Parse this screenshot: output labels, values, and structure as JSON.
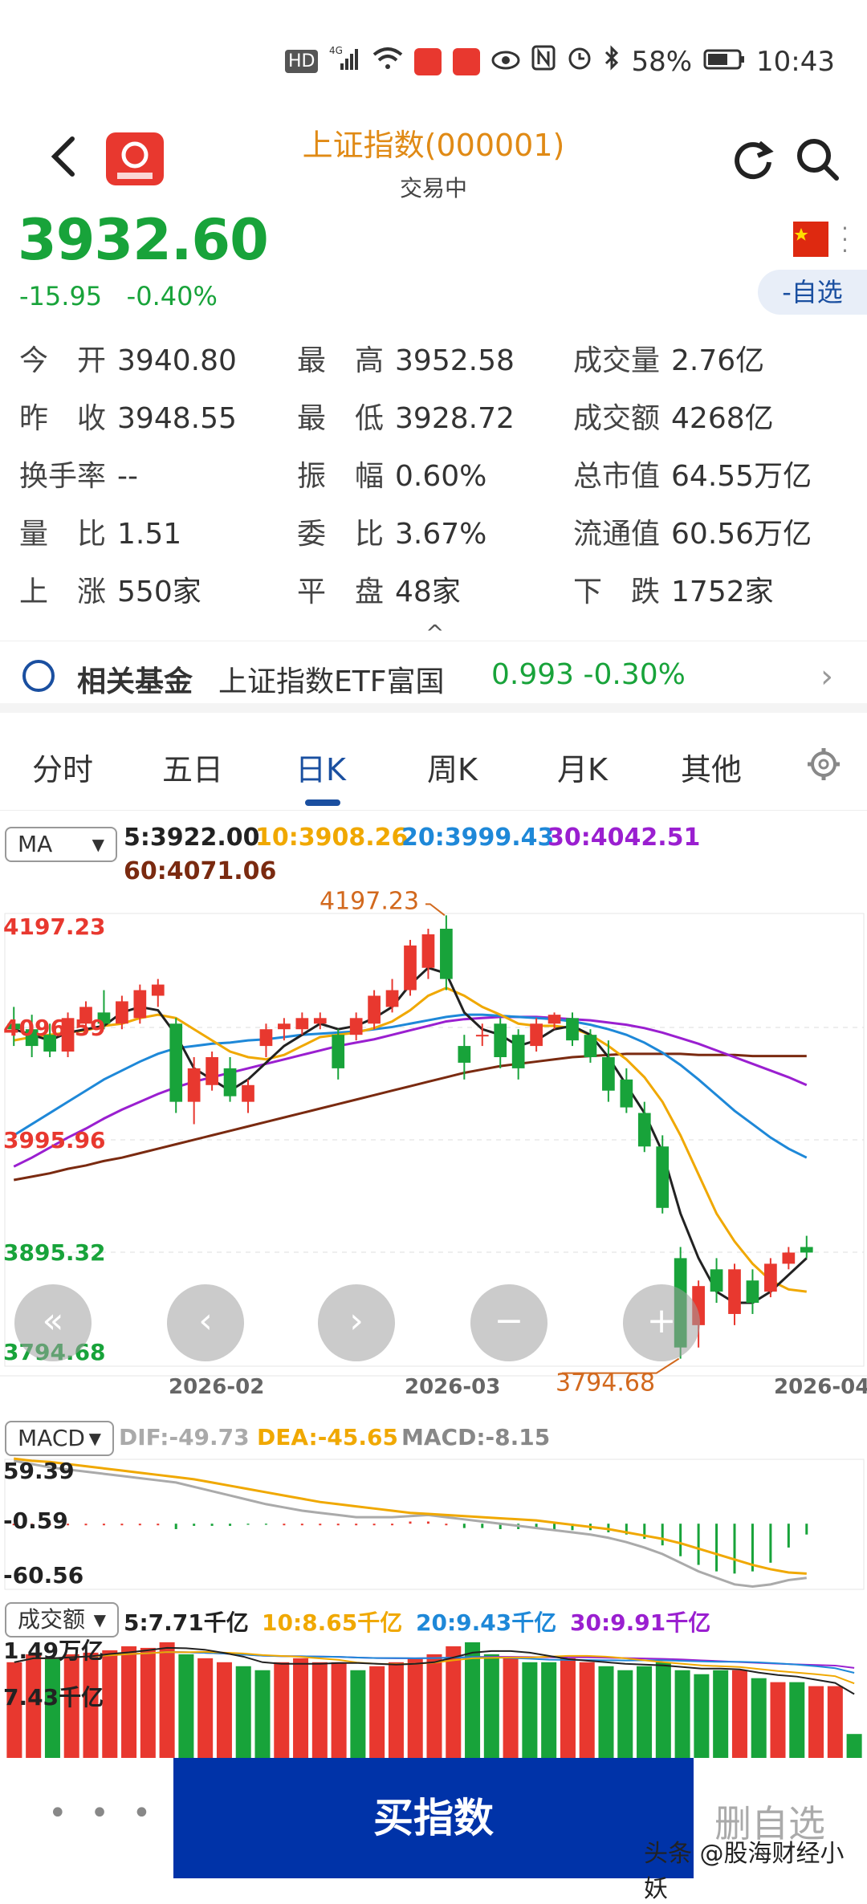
{
  "status_bar": {
    "battery": "58%",
    "time": "10:43",
    "hd": "HD",
    "net": "4G"
  },
  "header": {
    "title": "上证指数(000001)",
    "subtitle": "交易中"
  },
  "quote": {
    "price": "3932.60",
    "change": "-15.95",
    "change_pct": "-0.40%",
    "watch_label": "-自选"
  },
  "stats": [
    {
      "label": "今　开",
      "value": "3940.80"
    },
    {
      "label": "最　高",
      "value": "3952.58"
    },
    {
      "label": "成交量",
      "value": "2.76亿"
    },
    {
      "label": "昨　收",
      "value": "3948.55"
    },
    {
      "label": "最　低",
      "value": "3928.72"
    },
    {
      "label": "成交额",
      "value": "4268亿"
    },
    {
      "label": "换手率",
      "value": "--"
    },
    {
      "label": "振　幅",
      "value": "0.60%"
    },
    {
      "label": "总市值",
      "value": "64.55万亿"
    },
    {
      "label": "量　比",
      "value": "1.51"
    },
    {
      "label": "委　比",
      "value": "3.67%"
    },
    {
      "label": "流通值",
      "value": "60.56万亿"
    },
    {
      "label": "上　涨",
      "value": "550家"
    },
    {
      "label": "平　盘",
      "value": "48家"
    },
    {
      "label": "下　跌",
      "value": "1752家"
    }
  ],
  "fund": {
    "label": "相关基金",
    "name": "上证指数ETF富国",
    "value": "0.993 -0.30%"
  },
  "tabs": [
    "分时",
    "五日",
    "日K",
    "周K",
    "月K",
    "其他"
  ],
  "active_tab": "日K",
  "ma_panel": {
    "selector": "MA",
    "ma5": "5:3922.00",
    "ma10": "10:3908.26",
    "ma20": "20:3999.43",
    "ma30": "30:4042.51",
    "ma60": "60:4071.06"
  },
  "macd_panel": {
    "selector": "MACD",
    "dif": "DIF:-49.73",
    "dea": "DEA:-45.65",
    "macd": "MACD:-8.15"
  },
  "vol_panel": {
    "selector": "成交额",
    "ma5": "5:7.71千亿",
    "ma10": "10:8.65千亿",
    "ma20": "20:9.43千亿",
    "ma30": "30:9.91千亿"
  },
  "nav_buttons": [
    "«",
    "‹",
    "›",
    "−",
    "+"
  ],
  "bottom": {
    "more": "• • •",
    "buy": "买指数",
    "delete": "删自选",
    "watermark": "头条 @股海财经小妖"
  },
  "colors": {
    "up": "#e8382f",
    "down": "#18a33a",
    "ma5": "#222222",
    "ma10": "#f0a800",
    "ma20": "#1e88d8",
    "ma30": "#9a1fd0",
    "ma60": "#7a2a10",
    "accent": "#1a4fa0"
  },
  "chart_data": [
    {
      "type": "candlestick",
      "title": "",
      "x_labels": [
        "2026-02",
        "2026-03",
        "2026-04"
      ],
      "y_labels": [
        "4197.23",
        "4096.59",
        "3995.96",
        "3895.32",
        "3794.68"
      ],
      "ylim": [
        3794.68,
        4197.23
      ],
      "max_annotation": "4197.23",
      "min_annotation": "3794.68",
      "candles": [
        {
          "o": 4100,
          "h": 4115,
          "l": 4080,
          "c": 4095
        },
        {
          "o": 4095,
          "h": 4108,
          "l": 4070,
          "c": 4080
        },
        {
          "o": 4090,
          "h": 4100,
          "l": 4070,
          "c": 4075
        },
        {
          "o": 4075,
          "h": 4110,
          "l": 4070,
          "c": 4105
        },
        {
          "o": 4100,
          "h": 4120,
          "l": 4090,
          "c": 4115
        },
        {
          "o": 4110,
          "h": 4130,
          "l": 4095,
          "c": 4100
        },
        {
          "o": 4100,
          "h": 4125,
          "l": 4095,
          "c": 4120
        },
        {
          "o": 4105,
          "h": 4135,
          "l": 4100,
          "c": 4130
        },
        {
          "o": 4125,
          "h": 4140,
          "l": 4115,
          "c": 4135
        },
        {
          "o": 4100,
          "h": 4105,
          "l": 4020,
          "c": 4030
        },
        {
          "o": 4030,
          "h": 4070,
          "l": 4010,
          "c": 4060
        },
        {
          "o": 4045,
          "h": 4075,
          "l": 4040,
          "c": 4070
        },
        {
          "o": 4060,
          "h": 4070,
          "l": 4030,
          "c": 4035
        },
        {
          "o": 4030,
          "h": 4050,
          "l": 4020,
          "c": 4045
        },
        {
          "o": 4080,
          "h": 4100,
          "l": 4070,
          "c": 4095
        },
        {
          "o": 4095,
          "h": 4105,
          "l": 4085,
          "c": 4100
        },
        {
          "o": 4095,
          "h": 4110,
          "l": 4090,
          "c": 4105
        },
        {
          "o": 4100,
          "h": 4110,
          "l": 4095,
          "c": 4105
        },
        {
          "o": 4090,
          "h": 4095,
          "l": 4050,
          "c": 4060
        },
        {
          "o": 4090,
          "h": 4110,
          "l": 4085,
          "c": 4105
        },
        {
          "o": 4100,
          "h": 4130,
          "l": 4095,
          "c": 4125
        },
        {
          "o": 4115,
          "h": 4140,
          "l": 4110,
          "c": 4130
        },
        {
          "o": 4130,
          "h": 4175,
          "l": 4125,
          "c": 4170
        },
        {
          "o": 4150,
          "h": 4185,
          "l": 4140,
          "c": 4180
        },
        {
          "o": 4185,
          "h": 4197,
          "l": 4130,
          "c": 4140
        },
        {
          "o": 4080,
          "h": 4090,
          "l": 4050,
          "c": 4065
        },
        {
          "o": 4090,
          "h": 4100,
          "l": 4080,
          "c": 4090
        },
        {
          "o": 4100,
          "h": 4105,
          "l": 4060,
          "c": 4070
        },
        {
          "o": 4090,
          "h": 4095,
          "l": 4050,
          "c": 4060
        },
        {
          "o": 4080,
          "h": 4105,
          "l": 4075,
          "c": 4100
        },
        {
          "o": 4100,
          "h": 4110,
          "l": 4095,
          "c": 4108
        },
        {
          "o": 4105,
          "h": 4110,
          "l": 4080,
          "c": 4085
        },
        {
          "o": 4090,
          "h": 4095,
          "l": 4065,
          "c": 4070
        },
        {
          "o": 4070,
          "h": 4085,
          "l": 4030,
          "c": 4040
        },
        {
          "o": 4050,
          "h": 4060,
          "l": 4020,
          "c": 4025
        },
        {
          "o": 4020,
          "h": 4030,
          "l": 3985,
          "c": 3990
        },
        {
          "o": 3990,
          "h": 4000,
          "l": 3930,
          "c": 3935
        },
        {
          "o": 3890,
          "h": 3900,
          "l": 3800,
          "c": 3810
        },
        {
          "o": 3830,
          "h": 3870,
          "l": 3810,
          "c": 3865
        },
        {
          "o": 3880,
          "h": 3890,
          "l": 3850,
          "c": 3860
        },
        {
          "o": 3840,
          "h": 3885,
          "l": 3830,
          "c": 3880
        },
        {
          "o": 3870,
          "h": 3880,
          "l": 3840,
          "c": 3850
        },
        {
          "o": 3860,
          "h": 3890,
          "l": 3855,
          "c": 3885
        },
        {
          "o": 3885,
          "h": 3900,
          "l": 3880,
          "c": 3895
        },
        {
          "o": 3900,
          "h": 3910,
          "l": 3890,
          "c": 3895
        }
      ],
      "ma5": [
        4095,
        4090,
        4085,
        4092,
        4095,
        4098,
        4110,
        4115,
        4112,
        4090,
        4060,
        4050,
        4040,
        4050,
        4065,
        4080,
        4090,
        4100,
        4095,
        4098,
        4105,
        4115,
        4135,
        4150,
        4145,
        4110,
        4095,
        4090,
        4080,
        4085,
        4095,
        4098,
        4090,
        4070,
        4045,
        4020,
        3985,
        3930,
        3890,
        3860,
        3850,
        3850,
        3860,
        3875,
        3890
      ],
      "ma10": [
        4085,
        4088,
        4090,
        4092,
        4094,
        4098,
        4100,
        4105,
        4108,
        4105,
        4095,
        4085,
        4075,
        4070,
        4068,
        4072,
        4080,
        4088,
        4090,
        4092,
        4096,
        4102,
        4112,
        4125,
        4132,
        4125,
        4115,
        4108,
        4100,
        4098,
        4098,
        4096,
        4090,
        4080,
        4068,
        4052,
        4030,
        4000,
        3965,
        3930,
        3905,
        3885,
        3870,
        3862,
        3860
      ],
      "ma20": [
        4000,
        4010,
        4020,
        4030,
        4040,
        4050,
        4058,
        4066,
        4073,
        4078,
        4080,
        4082,
        4083,
        4085,
        4086,
        4088,
        4090,
        4091,
        4092,
        4093,
        4095,
        4097,
        4100,
        4103,
        4106,
        4108,
        4108,
        4107,
        4106,
        4105,
        4104,
        4102,
        4099,
        4095,
        4090,
        4083,
        4074,
        4063,
        4050,
        4036,
        4022,
        4010,
        3998,
        3988,
        3980
      ],
      "ma30": [
        3972,
        3980,
        3989,
        3998,
        4006,
        4015,
        4023,
        4030,
        4037,
        4043,
        4048,
        4052,
        4056,
        4060,
        4064,
        4068,
        4072,
        4076,
        4080,
        4083,
        4086,
        4090,
        4094,
        4098,
        4102,
        4104,
        4105,
        4106,
        4106,
        4106,
        4105,
        4104,
        4103,
        4101,
        4099,
        4096,
        4092,
        4087,
        4082,
        4076,
        4070,
        4064,
        4058,
        4052,
        4045
      ],
      "ma60": [
        3960,
        3963,
        3966,
        3970,
        3973,
        3977,
        3980,
        3984,
        3988,
        3992,
        3996,
        4000,
        4004,
        4008,
        4012,
        4016,
        4020,
        4024,
        4028,
        4032,
        4036,
        4040,
        4044,
        4048,
        4052,
        4056,
        4059,
        4062,
        4064,
        4066,
        4068,
        4070,
        4071,
        4072,
        4073,
        4073,
        4073,
        4073,
        4072,
        4072,
        4072,
        4071,
        4071,
        4071,
        4071
      ]
    },
    {
      "type": "bar",
      "title": "MACD",
      "y_labels": [
        "59.39",
        "-0.59",
        "-60.56"
      ],
      "ylim": [
        -60.56,
        59.39
      ],
      "values": [
        0,
        0,
        0,
        0,
        0,
        0,
        0,
        0,
        0,
        -5,
        -2,
        -2,
        -2,
        -1,
        -1,
        0,
        0,
        0,
        0,
        0,
        0,
        0,
        2,
        2,
        0,
        -4,
        -4,
        -5,
        -5,
        -5,
        -5,
        -6,
        -6,
        -8,
        -10,
        -14,
        -20,
        -30,
        -38,
        -44,
        -46,
        -44,
        -36,
        -22,
        -10
      ],
      "dif": [
        58,
        55,
        52,
        50,
        48,
        46,
        44,
        42,
        40,
        38,
        34,
        30,
        26,
        22,
        18,
        15,
        12,
        10,
        8,
        6,
        6,
        6,
        7,
        8,
        6,
        4,
        2,
        0,
        -2,
        -4,
        -6,
        -8,
        -10,
        -13,
        -17,
        -22,
        -28,
        -36,
        -44,
        -50,
        -56,
        -58,
        -56,
        -52,
        -50
      ],
      "dea": [
        60,
        58,
        57,
        55,
        53,
        51,
        49,
        47,
        45,
        43,
        41,
        38,
        35,
        32,
        29,
        26,
        23,
        20,
        18,
        16,
        14,
        12,
        10,
        9,
        8,
        7,
        6,
        5,
        4,
        3,
        1,
        -1,
        -3,
        -5,
        -8,
        -11,
        -14,
        -18,
        -23,
        -28,
        -33,
        -38,
        -42,
        -45,
        -46
      ]
    },
    {
      "type": "bar",
      "title": "成交额",
      "y_labels": [
        "1.49万亿",
        "7.43千亿"
      ],
      "ylim": [
        0,
        1.49
      ],
      "values": [
        1.2,
        1.3,
        1.25,
        1.3,
        1.32,
        1.35,
        1.4,
        1.38,
        1.45,
        1.3,
        1.25,
        1.2,
        1.15,
        1.1,
        1.2,
        1.25,
        1.2,
        1.2,
        1.1,
        1.15,
        1.2,
        1.25,
        1.3,
        1.4,
        1.45,
        1.3,
        1.25,
        1.2,
        1.2,
        1.25,
        1.2,
        1.15,
        1.1,
        1.15,
        1.2,
        1.1,
        1.05,
        1.1,
        1.1,
        1.0,
        0.95,
        0.95,
        0.9,
        0.9,
        0.3
      ],
      "up": [
        1,
        1,
        0,
        1,
        1,
        1,
        1,
        1,
        1,
        0,
        1,
        1,
        0,
        0,
        1,
        1,
        1,
        1,
        0,
        1,
        1,
        1,
        1,
        1,
        0,
        0,
        1,
        0,
        0,
        1,
        1,
        0,
        0,
        0,
        0,
        0,
        0,
        0,
        1,
        0,
        1,
        0,
        1,
        1,
        0
      ]
    }
  ]
}
